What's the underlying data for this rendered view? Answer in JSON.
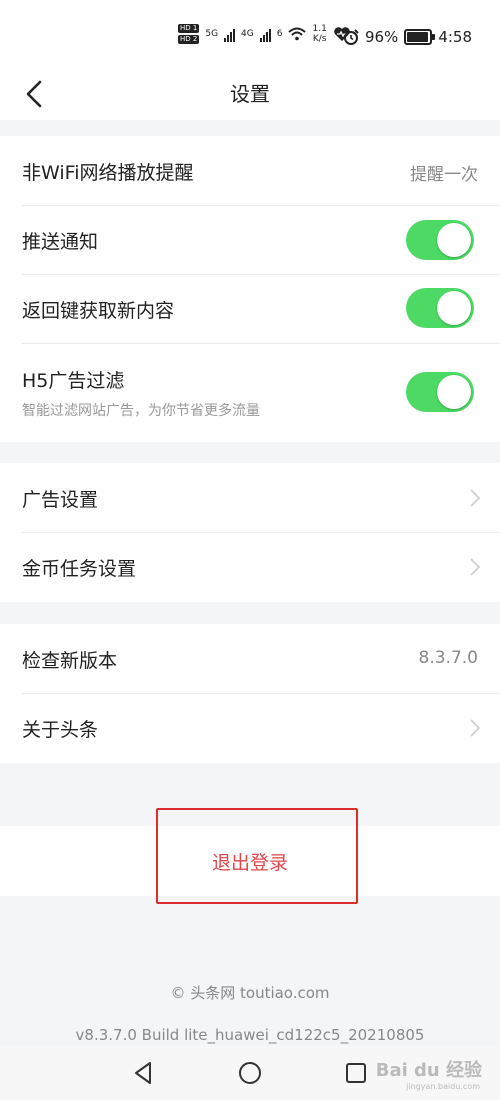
{
  "status_bar": {
    "hd1": "HD 1",
    "hd2": "HD 2",
    "sig1": "5G",
    "sig2": "4G",
    "wifi": "6",
    "net_speed_value": "1.1",
    "net_speed_unit": "K/s",
    "battery": "96%",
    "time": "4:58"
  },
  "header": {
    "title": "设置"
  },
  "group1": {
    "rows": [
      {
        "label": "非WiFi网络播放提醒",
        "value": "提醒一次"
      },
      {
        "label": "推送通知",
        "on": true
      },
      {
        "label": "返回键获取新内容",
        "on": true
      },
      {
        "label": "H5广告过滤",
        "subtitle": "智能过滤网站广告，为你节省更多流量",
        "on": true
      }
    ]
  },
  "group2": {
    "rows": [
      {
        "label": "广告设置"
      },
      {
        "label": "金币任务设置"
      }
    ]
  },
  "group3": {
    "rows": [
      {
        "label": "检查新版本",
        "value": "8.3.7.0"
      },
      {
        "label": "关于头条"
      }
    ]
  },
  "logout": {
    "label": "退出登录"
  },
  "footer": {
    "copyright": "© 头条网 toutiao.com",
    "build": "v8.3.7.0 Build lite_huawei_cd122c5_20210805"
  },
  "watermark": {
    "brand": "Bai du 经验",
    "sub": "jingyan.baidu.com"
  },
  "colors": {
    "toggle_on": "#4cd964",
    "logout_text": "#e0474b",
    "highlight_box": "#e02b2b"
  }
}
